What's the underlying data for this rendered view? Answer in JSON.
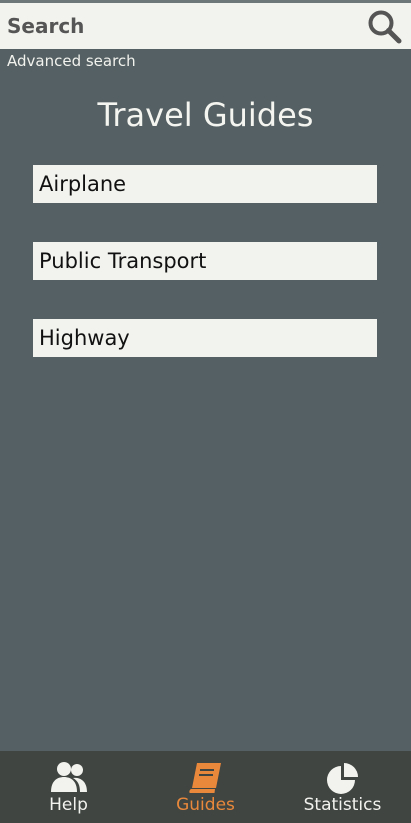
{
  "search": {
    "placeholder": "Search",
    "icon": "search-icon",
    "advanced_label": "Advanced search"
  },
  "main": {
    "title": "Travel Guides",
    "guides": [
      {
        "label": "Airplane"
      },
      {
        "label": "Public Transport"
      },
      {
        "label": "Highway"
      }
    ]
  },
  "bottom_nav": {
    "items": [
      {
        "label": "Help",
        "icon": "people-icon",
        "active": false
      },
      {
        "label": "Guides",
        "icon": "book-icon",
        "active": true
      },
      {
        "label": "Statistics",
        "icon": "pie-chart-icon",
        "active": false
      }
    ]
  },
  "colors": {
    "background": "#546063",
    "surface": "#f2f2ee",
    "nav_background": "#404542",
    "accent": "#e9883b"
  }
}
